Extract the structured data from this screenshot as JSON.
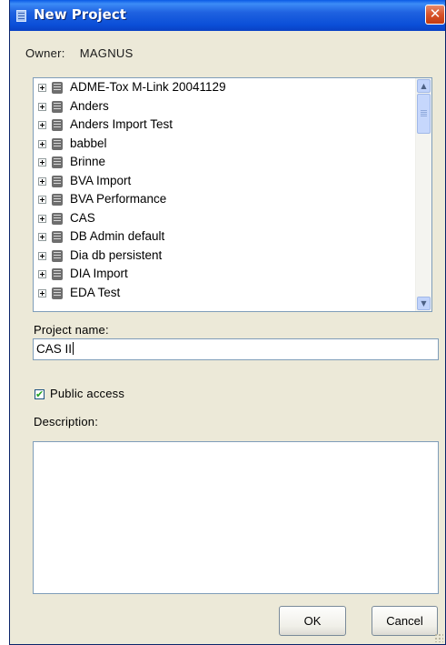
{
  "window": {
    "title": "New Project",
    "icon": "app-icon",
    "close_glyph": "✕"
  },
  "owner": {
    "label": "Owner:",
    "value": "MAGNUS"
  },
  "projects": [
    "ADME-Tox M-Link 20041129",
    "Anders",
    "Anders Import Test",
    "babbel",
    "Brinne",
    "BVA Import",
    "BVA Performance",
    "CAS",
    "DB Admin default",
    "Dia db persistent",
    "DIA Import",
    "EDA Test"
  ],
  "project_name": {
    "label": "Project name:",
    "value": "CAS II"
  },
  "public_access": {
    "label": "Public access",
    "checked": true,
    "check_glyph": "✔"
  },
  "description": {
    "label": "Description:",
    "value": ""
  },
  "buttons": {
    "ok": "OK",
    "cancel": "Cancel"
  },
  "colors": {
    "title_bar": "#0b4fd8",
    "dialog_bg": "#ece9d8",
    "close_button": "#d8532a"
  }
}
